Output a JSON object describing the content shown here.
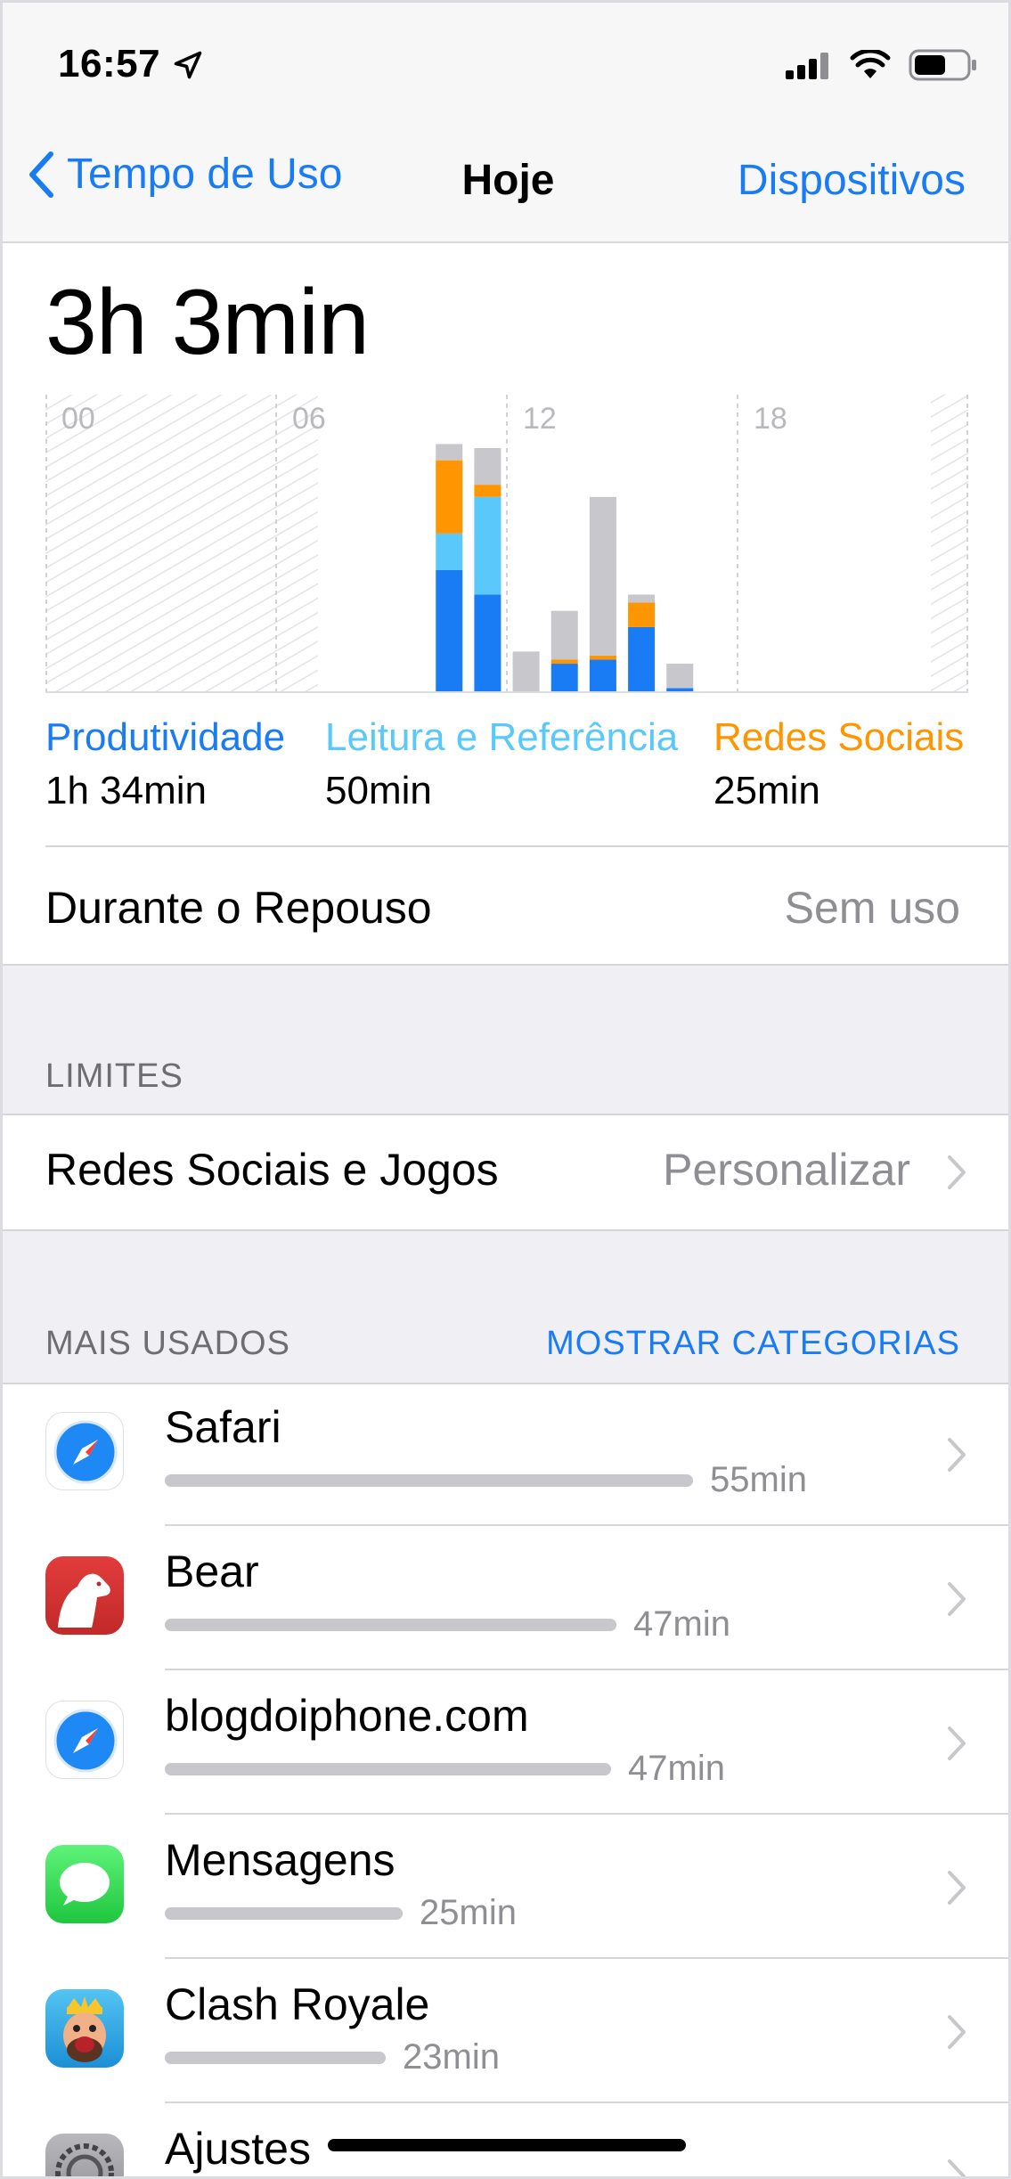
{
  "status_bar": {
    "time": "16:57",
    "battery_level": 0.6
  },
  "nav": {
    "back_label": "Tempo de Uso",
    "title": "Hoje",
    "right_label": "Dispositivos"
  },
  "total_time": "3h 3min",
  "chart_data": {
    "type": "bar",
    "stacked": true,
    "x_tick_labels": [
      "00",
      "06",
      "12",
      "18"
    ],
    "x_unit": "hour",
    "y_unit": "minutes",
    "ylim": [
      0,
      60
    ],
    "categories": [
      "10",
      "11",
      "12",
      "13",
      "14",
      "15",
      "16"
    ],
    "series": [
      {
        "name": "Produtividade",
        "color": "#1a7cf4",
        "values": [
          30,
          24,
          0,
          7,
          8,
          16,
          1
        ]
      },
      {
        "name": "Leitura e Referência",
        "color": "#5ac8fa",
        "values": [
          9,
          24,
          0,
          0,
          0,
          0,
          0
        ]
      },
      {
        "name": "Redes Sociais",
        "color": "#ff9500",
        "values": [
          18,
          3,
          0,
          1,
          1,
          6,
          0
        ]
      },
      {
        "name": "",
        "color": "#c7c7cc",
        "values": [
          4,
          9,
          10,
          12,
          39,
          2,
          6
        ]
      }
    ],
    "grid": true
  },
  "legend": [
    {
      "label": "Produtividade",
      "value": "1h 34min",
      "color": "#1a7cf4"
    },
    {
      "label": "Leitura e Referência",
      "value": "50min",
      "color": "#5ac8fa"
    },
    {
      "label": "Redes Sociais",
      "value": "25min",
      "color": "#ff9500"
    }
  ],
  "downtime": {
    "label": "Durante o Repouso",
    "value": "Sem uso"
  },
  "limits": {
    "header": "LIMITES",
    "row_label": "Redes Sociais e Jogos",
    "row_value": "Personalizar"
  },
  "most_used": {
    "header": "MAIS USADOS",
    "link": "MOSTRAR CATEGORIAS",
    "apps": [
      {
        "name": "Safari",
        "time": "55min",
        "minutes": 55,
        "icon": "safari-icon"
      },
      {
        "name": "Bear",
        "time": "47min",
        "minutes": 47,
        "icon": "bear-icon"
      },
      {
        "name": "blogdoiphone.com",
        "time": "47min",
        "minutes": 47,
        "icon": "safari-icon"
      },
      {
        "name": "Mensagens",
        "time": "25min",
        "minutes": 25,
        "icon": "messages-icon"
      },
      {
        "name": "Clash Royale",
        "time": "23min",
        "minutes": 23,
        "icon": "clash-royale-icon"
      },
      {
        "name": "Ajustes",
        "time": "",
        "minutes": 0,
        "icon": "settings-icon"
      }
    ]
  }
}
